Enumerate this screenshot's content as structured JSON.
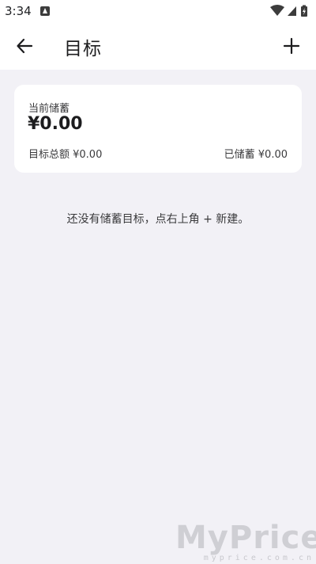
{
  "status_bar": {
    "time": "3:34"
  },
  "app_bar": {
    "title": "目标",
    "back_icon": "arrow-left-icon",
    "add_icon": "plus-icon"
  },
  "savings_card": {
    "label": "当前储蓄",
    "amount": "¥0.00",
    "target_total": "目标总额 ¥0.00",
    "saved": "已储蓄 ¥0.00"
  },
  "empty_state": {
    "message": "还没有储蓄目标，点右上角 + 新建。"
  },
  "watermark": {
    "logo": "MyPrice",
    "domain": "myprice.com.cn"
  },
  "colors": {
    "background": "#f2f1f6",
    "surface": "#ffffff",
    "text": "#1c1c1e"
  }
}
